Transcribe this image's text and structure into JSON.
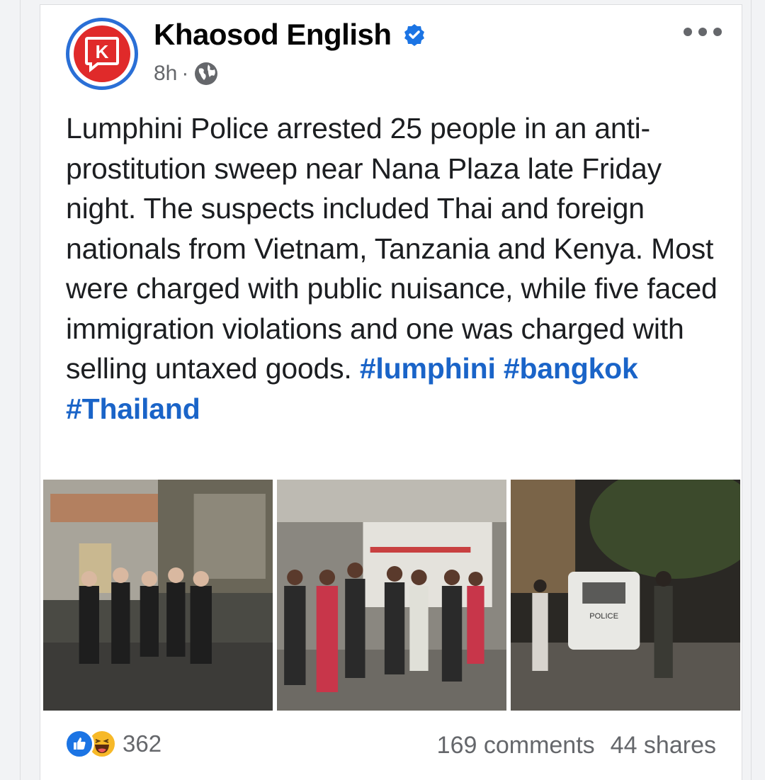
{
  "post": {
    "page_name": "Khaosod English",
    "time": "8h",
    "separator": "·",
    "text": "Lumphini Police arrested 25 people in an anti-prostitution sweep near Nana Plaza late Friday night. The suspects included Thai and foreign nationals from Vietnam, Tanzania and Kenya. Most were charged with public nuisance, while five faced immigration violations and one was charged with selling untaxed goods.",
    "hashtags": [
      "#lumphini",
      "#bangkok",
      "#Thailand"
    ],
    "avatar_letter": "K",
    "icons": {
      "verified": "verified-badge-icon",
      "audience": "globe-icon",
      "more": "more-options-icon",
      "like": "like-reaction-icon",
      "haha": "haha-reaction-icon"
    },
    "colors": {
      "brand": "#e02a2a",
      "hashtag": "#1a64c8",
      "like": "#1b74e4"
    }
  },
  "engagement": {
    "reactions_count": "362",
    "comments": "169 comments",
    "shares": "44 shares"
  },
  "photos": [
    {
      "label": "police-sweep-photo-1"
    },
    {
      "label": "police-sweep-photo-2"
    },
    {
      "label": "police-sweep-photo-3",
      "van_text": "POLICE"
    }
  ]
}
